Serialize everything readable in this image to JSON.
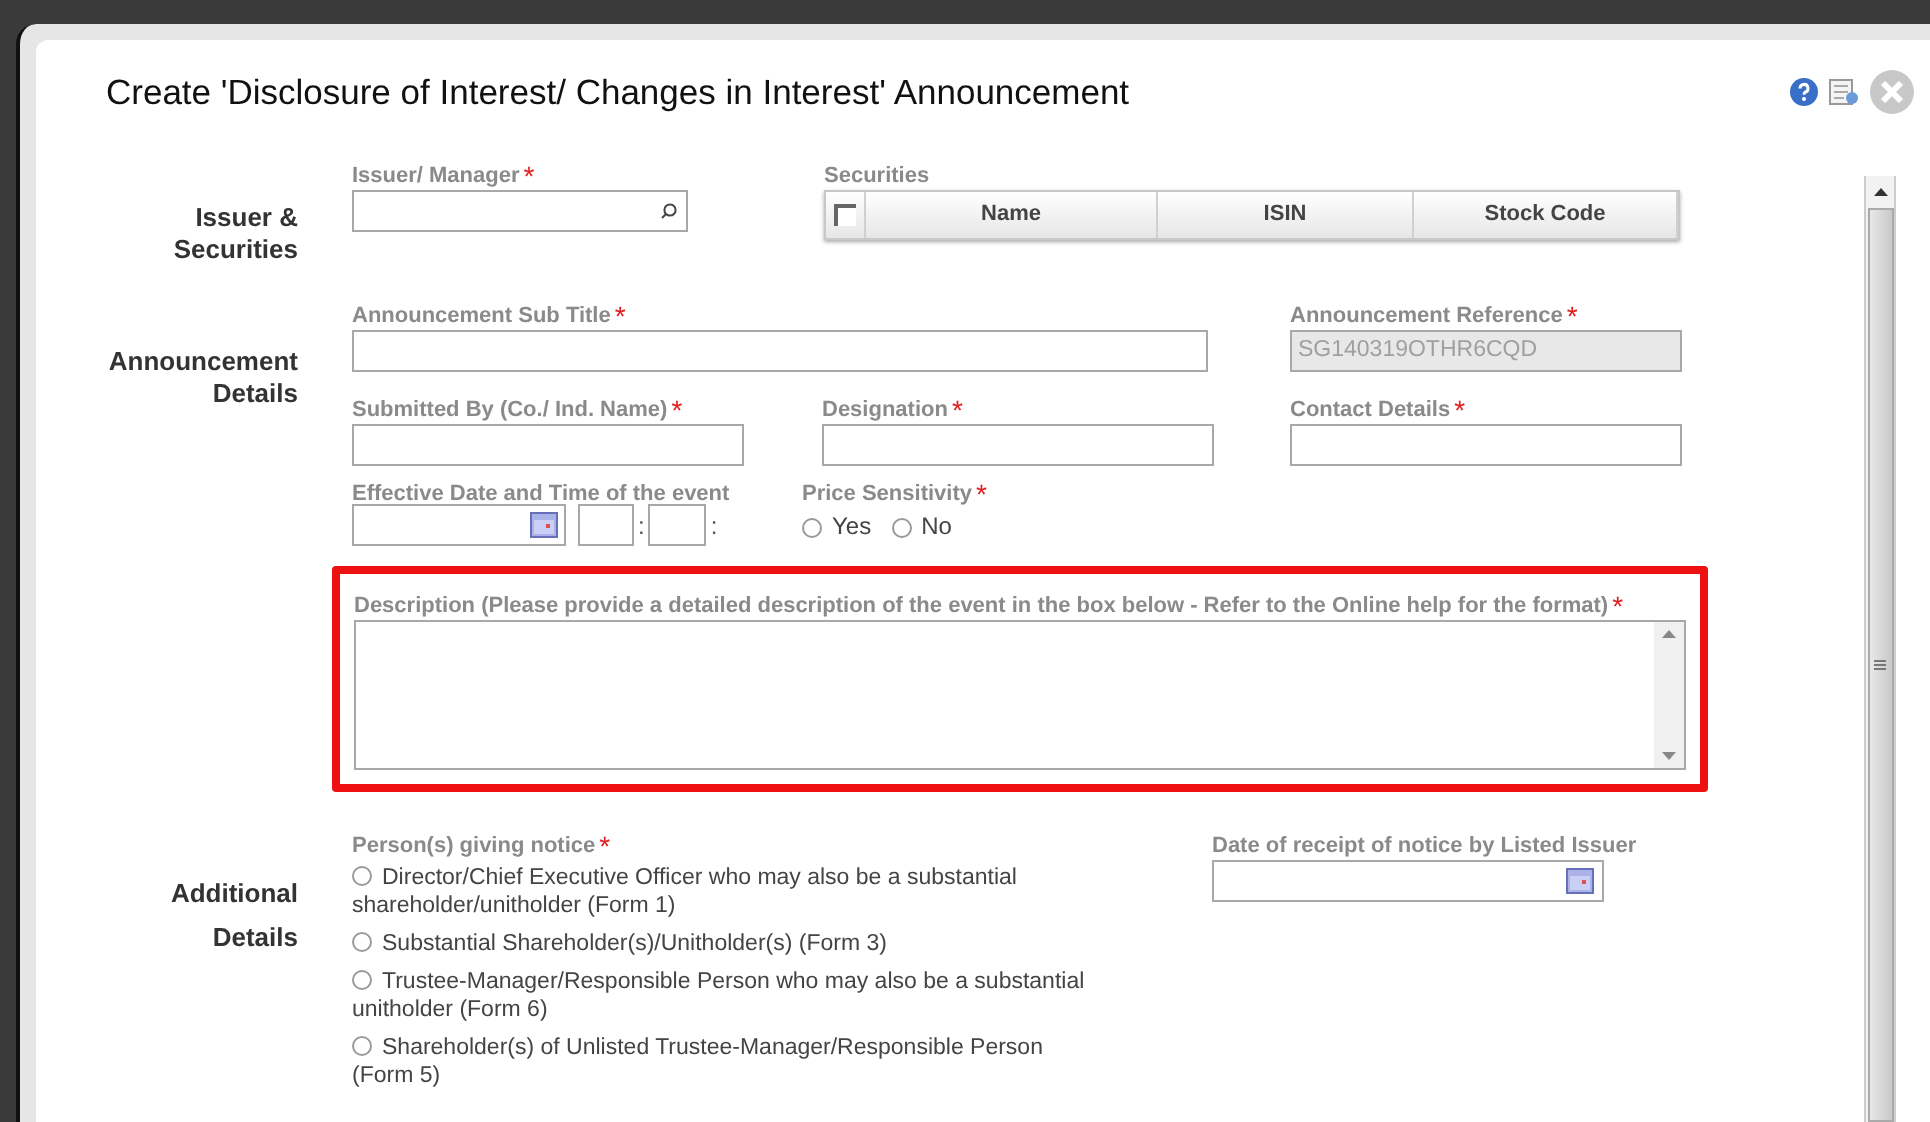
{
  "dialog": {
    "title": "Create 'Disclosure of Interest/ Changes in Interest' Announcement"
  },
  "issuer_section": {
    "label": "Issuer & Securities",
    "issuer_field": {
      "label": "Issuer/ Manager",
      "marker": "*"
    },
    "securities": {
      "label": "Securities",
      "select_all_checked": false,
      "columns": [
        "Name",
        "ISIN",
        "Stock Code"
      ]
    }
  },
  "announcement_section": {
    "label": "Announcement Details",
    "sub_title": {
      "label": "Announcement Sub Title",
      "marker": "*"
    },
    "reference": {
      "label": "Announcement Reference",
      "marker": "*",
      "value": "SG140319OTHR6CQD"
    },
    "submitted_by": {
      "label": "Submitted By (Co./ Ind. Name)",
      "marker": "*"
    },
    "designation": {
      "label": "Designation",
      "marker": "*"
    },
    "contact": {
      "label": "Contact Details",
      "marker": "*"
    },
    "effective": {
      "label": "Effective Date and Time of the event",
      "separators": [
        ":",
        ":"
      ]
    },
    "price_sensitivity": {
      "label": "Price Sensitivity",
      "marker": "*",
      "options": [
        {
          "label": "Yes",
          "selected": false
        },
        {
          "label": "No",
          "selected": false
        }
      ]
    },
    "description": {
      "label": "Description (Please provide a detailed description of the event in the box below - Refer to the Online help for the format)",
      "marker": "*"
    }
  },
  "additional_section": {
    "label": "Additional Details",
    "persons": {
      "label": "Person(s) giving notice",
      "marker": "*",
      "options": [
        {
          "label": "Director/Chief Executive Officer who may also be a substantial shareholder/unitholder (Form 1)",
          "selected": false
        },
        {
          "label": "Substantial Shareholder(s)/Unitholder(s) (Form 3)",
          "selected": false
        },
        {
          "label": "Trustee-Manager/Responsible Person who may also be a substantial unitholder (Form 6)",
          "selected": false
        },
        {
          "label": "Shareholder(s) of Unlisted Trustee-Manager/Responsible Person (Form 5)",
          "selected": false
        }
      ]
    },
    "receipt_date": {
      "label": "Date of receipt of notice by Listed Issuer"
    }
  }
}
